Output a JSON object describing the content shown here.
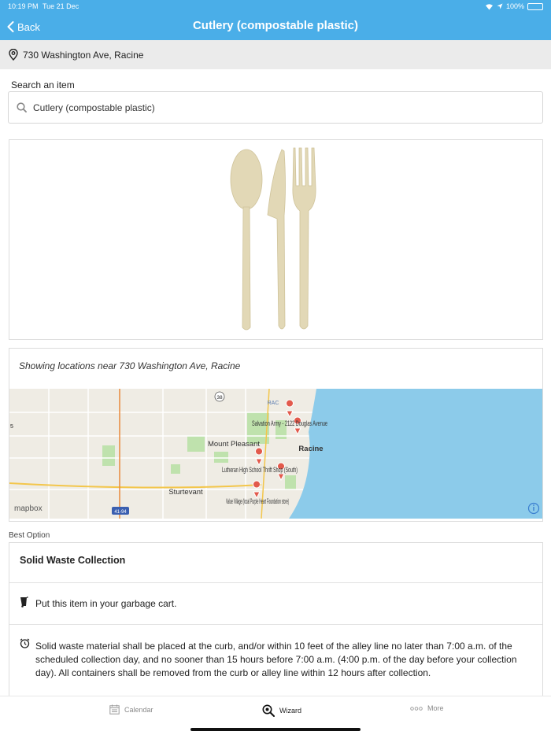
{
  "status": {
    "time": "10:19 PM",
    "date": "Tue 21 Dec",
    "battery": "100%",
    "battery_level": 1.0
  },
  "nav": {
    "back_label": "Back",
    "title": "Cutlery (compostable plastic)"
  },
  "address": {
    "text": "730 Washington Ave, Racine",
    "icon": "location-pin-icon"
  },
  "search": {
    "label": "Search an item",
    "value": "Cutlery (compostable plastic)",
    "icon": "search-icon"
  },
  "item_image": {
    "alt": "spoon, knife and fork",
    "color": "#e2d8b6"
  },
  "locations": {
    "heading": "Showing locations near 730 Washington Ave, Racine",
    "map": {
      "places": [
        "Mount Pleasant",
        "Racine",
        "Sturtevant"
      ],
      "markers": [
        "Salvation Army - 2122 Douglas Avenue",
        "Lutheran High School Thrift Shop (South)",
        "Value Village (local Purple Heart Foundation store)"
      ],
      "road_labels": [
        "38",
        "41-94",
        "RAC",
        "5"
      ],
      "attribution": "mapbox",
      "water_color": "#8ccbea",
      "land_color": "#efece4",
      "park_color": "#bfe2ad"
    }
  },
  "best_option": {
    "label": "Best Option",
    "title": "Solid Waste Collection",
    "instruction": "Put this item in your garbage cart.",
    "instruction_icon": "garbage-cart-icon",
    "details": "Solid waste material shall be placed at the curb, and/or within 10 feet of the alley line no later than 7:00 a.m. of the scheduled collection day, and no sooner than 15 hours before 7:00 a.m. (4:00 p.m. of the day before your collection day). All containers shall be removed from the curb or alley line within 12 hours after collection.",
    "details_icon": "alarm-clock-icon"
  },
  "tabs": [
    {
      "label": "Calendar",
      "icon": "calendar-icon",
      "active": false
    },
    {
      "label": "Wizard",
      "icon": "wizard-search-icon",
      "active": true
    },
    {
      "label": "More",
      "icon": "more-dots-icon",
      "active": false
    }
  ]
}
